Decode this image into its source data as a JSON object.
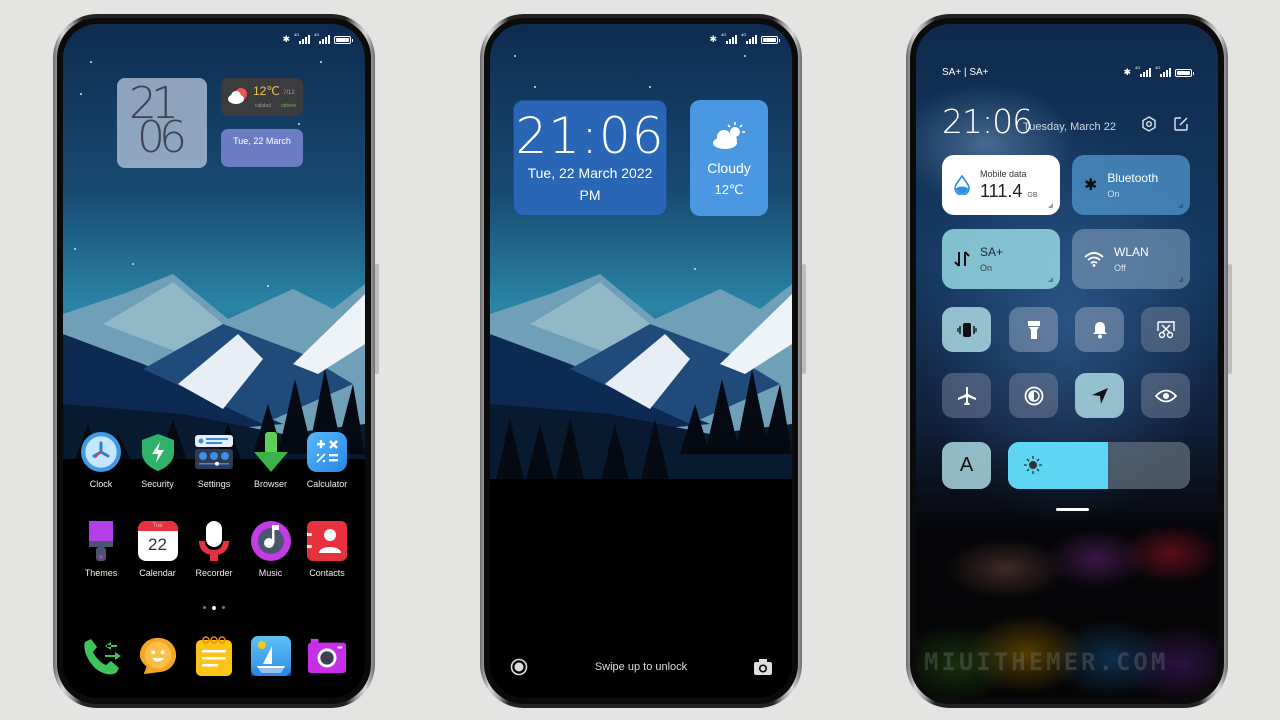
{
  "status_bar": {
    "bluetooth": "bluetooth-icon",
    "network_1": "4G",
    "network_2": "4G",
    "battery_level": 1.0
  },
  "home_screen": {
    "clock_widget": {
      "hours": "21",
      "minutes": "06"
    },
    "weather_widget": {
      "temperature": "12℃",
      "range_low": "7",
      "range_high": "/12",
      "quality_label": "calidad",
      "quality_value": "obtene"
    },
    "date_widget": {
      "text": "Tue, 22 March"
    },
    "apps_row1": [
      {
        "label": "Clock",
        "icon": "clock-icon"
      },
      {
        "label": "Security",
        "icon": "security-shield-icon"
      },
      {
        "label": "Settings",
        "icon": "settings-icon"
      },
      {
        "label": "Browser",
        "icon": "browser-arrow-icon"
      },
      {
        "label": "Calculator",
        "icon": "calculator-icon"
      }
    ],
    "apps_row2": [
      {
        "label": "Themes",
        "icon": "themes-brush-icon"
      },
      {
        "label": "Calendar",
        "icon": "calendar-icon",
        "day": "22",
        "weekday": "Tue"
      },
      {
        "label": "Recorder",
        "icon": "microphone-icon"
      },
      {
        "label": "Music",
        "icon": "music-icon"
      },
      {
        "label": "Contacts",
        "icon": "contacts-icon"
      }
    ],
    "pager": {
      "pages": 3,
      "current": 2
    },
    "dock": [
      {
        "icon": "phone-icon"
      },
      {
        "icon": "messaging-icon"
      },
      {
        "icon": "notes-icon"
      },
      {
        "icon": "gallery-icon"
      },
      {
        "icon": "camera-icon"
      }
    ]
  },
  "lock_screen": {
    "time": "21:06",
    "date": "Tue, 22 March 2022",
    "ampm": "PM",
    "weather_condition": "Cloudy",
    "weather_temp": "12℃",
    "unlock_hint": "Swipe up to unlock"
  },
  "control_center": {
    "carrier": "SA+ | SA+",
    "time": "21:06",
    "date": "Tuesday, March 22",
    "mobile_data": {
      "title": "Mobile data",
      "value": "111.4",
      "unit": "GB"
    },
    "bluetooth": {
      "title": "Bluetooth",
      "status": "On"
    },
    "sim": {
      "title": "SA+",
      "status": "On"
    },
    "wlan": {
      "title": "WLAN",
      "status": "Off"
    },
    "toggles_row1": [
      {
        "icon": "vibrate-icon",
        "state": "on"
      },
      {
        "icon": "flashlight-icon",
        "state": "off"
      },
      {
        "icon": "bell-icon",
        "state": "off"
      },
      {
        "icon": "screenshot-icon",
        "state": "off"
      }
    ],
    "toggles_row2": [
      {
        "icon": "airplane-icon",
        "state": "off"
      },
      {
        "icon": "dark-mode-icon",
        "state": "off"
      },
      {
        "icon": "location-icon",
        "state": "on"
      },
      {
        "icon": "eye-icon",
        "state": "off"
      }
    ],
    "auto_brightness_label": "A",
    "brightness_percent": 55,
    "watermark": "MIUITHEMER.COM"
  }
}
